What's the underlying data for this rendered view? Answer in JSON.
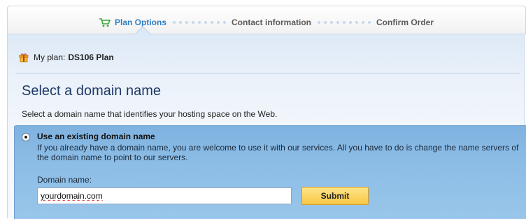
{
  "steps": {
    "step1": "Plan Options",
    "step2": "Contact information",
    "step3": "Confirm Order"
  },
  "plan": {
    "label": "My plan:",
    "name": "DS106 Plan"
  },
  "page": {
    "title": "Select a domain name",
    "subtitle": "Select a domain name that identifies your hosting space on the Web."
  },
  "option": {
    "title": "Use an existing domain name",
    "description": "If you already have a domain name, you are welcome to use it with our services. All you have to do is change the name servers of the domain name to point to our servers.",
    "field_label": "Domain name:",
    "input_value": "yourdomain.com",
    "submit_label": "Submit"
  },
  "colors": {
    "active_step": "#2f7fc4",
    "selected_option_bg": "#8cbde6",
    "submit_button": "#f8c744",
    "title_text": "#1f3a66"
  },
  "icons": {
    "cart": "cart-icon",
    "gift": "gift-icon",
    "radio": "radio-selected"
  }
}
